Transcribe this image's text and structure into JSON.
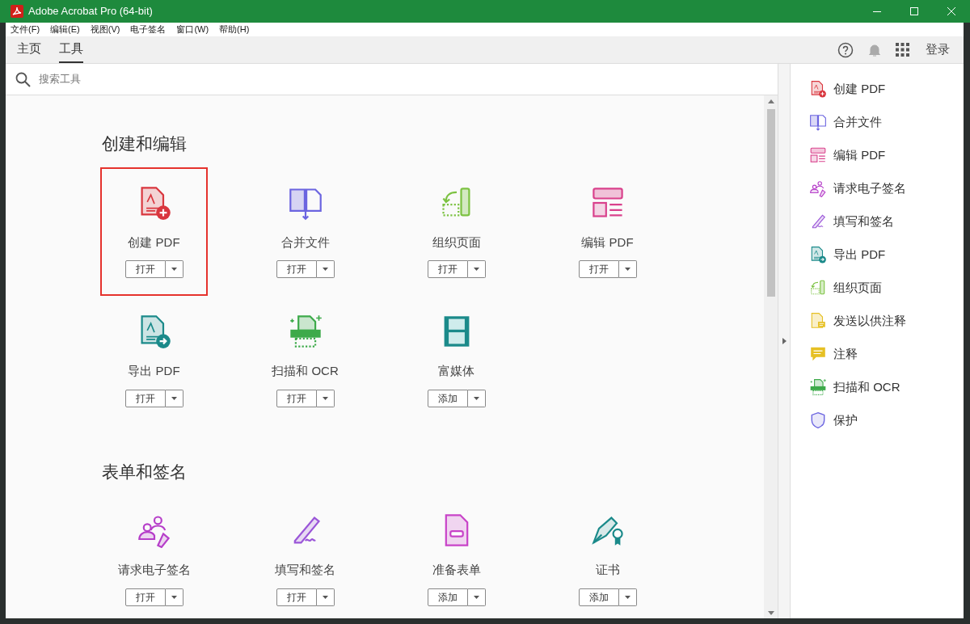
{
  "window": {
    "title": "Adobe Acrobat Pro (64-bit)"
  },
  "menu": [
    "文件(F)",
    "编辑(E)",
    "视图(V)",
    "电子签名",
    "窗口(W)",
    "帮助(H)"
  ],
  "tabs": [
    {
      "label": "主页",
      "selected": false
    },
    {
      "label": "工具",
      "selected": true
    }
  ],
  "sign_in": "登录",
  "search": {
    "placeholder": "搜索工具"
  },
  "sections": [
    {
      "title": "创建和编辑",
      "tools": [
        {
          "label": "创建 PDF",
          "button": "打开",
          "selected": true
        },
        {
          "label": "合并文件",
          "button": "打开",
          "selected": false
        },
        {
          "label": "组织页面",
          "button": "打开",
          "selected": false
        },
        {
          "label": "编辑 PDF",
          "button": "打开",
          "selected": false
        },
        {
          "label": "导出 PDF",
          "button": "打开",
          "selected": false
        },
        {
          "label": "扫描和 OCR",
          "button": "打开",
          "selected": false
        },
        {
          "label": "富媒体",
          "button": "添加",
          "selected": false
        }
      ]
    },
    {
      "title": "表单和签名",
      "tools": [
        {
          "label": "请求电子签名",
          "button": "打开",
          "selected": false
        },
        {
          "label": "填写和签名",
          "button": "打开",
          "selected": false
        },
        {
          "label": "准备表单",
          "button": "添加",
          "selected": false
        },
        {
          "label": "证书",
          "button": "添加",
          "selected": false
        }
      ]
    }
  ],
  "right_panel": [
    "创建 PDF",
    "合并文件",
    "编辑 PDF",
    "请求电子签名",
    "填写和签名",
    "导出 PDF",
    "组织页面",
    "发送以供注释",
    "注释",
    "扫描和 OCR",
    "保护"
  ]
}
